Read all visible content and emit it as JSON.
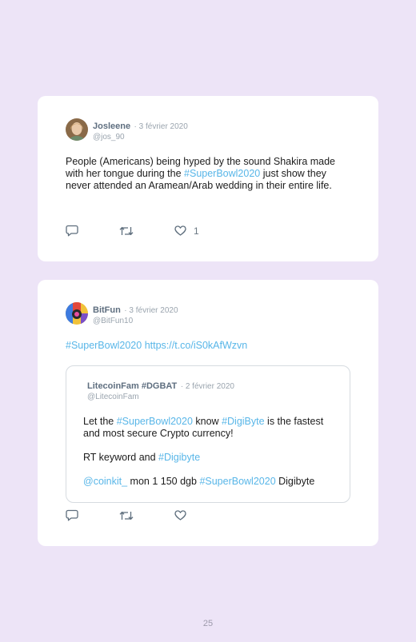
{
  "tweets": [
    {
      "author": "Josleene",
      "date": "· 3 février 2020",
      "handle": "@jos_90",
      "text_parts": {
        "a": "People (Americans) being hyped by the sound Shakira made with her tongue during the ",
        "hashtag": "#SuperBowl2020",
        "b": " just show they never attended an Aramean/Arab wedding in their entire life."
      },
      "like_count": "1"
    },
    {
      "author": "BitFun",
      "date": "· 3 février 2020",
      "handle": "@BitFun10",
      "hashtag": "#SuperBowl2020",
      "url": "https://t.co/iS0kAfWzvn",
      "quote": {
        "author": "LitecoinFam #DGBAT",
        "date": "· 2 février 2020",
        "handle": "@LitecoinFam",
        "line1": {
          "a": "Let the ",
          "hashtag1": "#SuperBowl2020",
          "b": " know ",
          "hashtag2": "#DigiByte",
          "c": " is the fastest and most secure Crypto currency!"
        },
        "line2": {
          "a": "RT keyword and ",
          "hashtag": "#Digibyte"
        },
        "line3": {
          "mention": "@coinkit_",
          "a": " mon 1 150 dgb ",
          "hashtag": "#SuperBowl2020",
          "b": " Digibyte"
        }
      }
    }
  ],
  "page_number": "25",
  "colors": {
    "background": "#ede4f7",
    "link": "#58b6e8",
    "name": "#5e6e7f",
    "muted": "#9aa4ae"
  },
  "icons": [
    "reply-icon",
    "retweet-icon",
    "like-icon"
  ]
}
